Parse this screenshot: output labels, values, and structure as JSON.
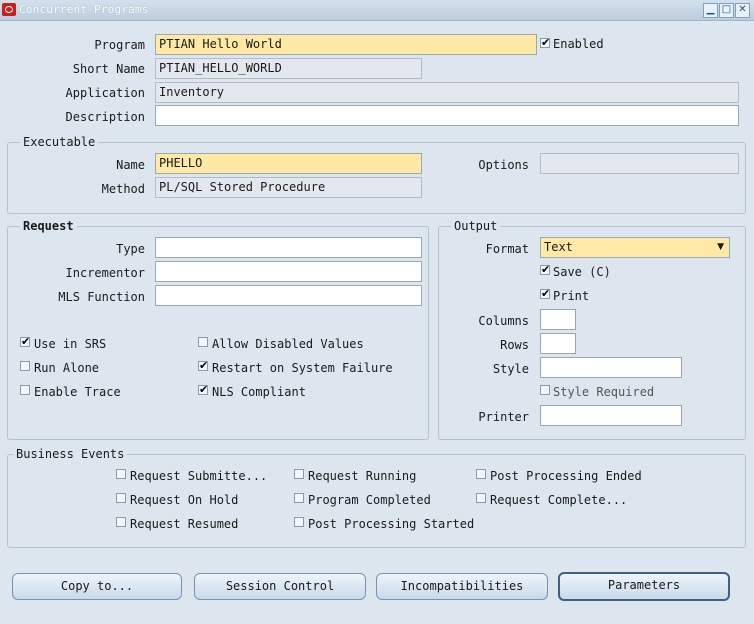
{
  "window": {
    "title": "Concurrent Programs",
    "minimize_icon": "minimize-icon",
    "maximize_icon": "maximize-icon",
    "close_icon": "close-icon"
  },
  "program": {
    "program_label": "Program",
    "program_value": "PTIAN Hello World",
    "enabled_label": "Enabled",
    "enabled_checked": true,
    "short_name_label": "Short Name",
    "short_name_value": "PTIAN_HELLO_WORLD",
    "application_label": "Application",
    "application_value": "Inventory",
    "description_label": "Description",
    "description_value": ""
  },
  "executable": {
    "title": "Executable",
    "name_label": "Name",
    "name_value": "PHELLO",
    "method_label": "Method",
    "method_value": "PL/SQL Stored Procedure",
    "options_label": "Options",
    "options_value": ""
  },
  "request": {
    "title": "Request",
    "type_label": "Type",
    "type_value": "",
    "incrementor_label": "Incrementor",
    "incrementor_value": "",
    "mls_label": "MLS Function",
    "mls_value": "",
    "use_in_srs": {
      "label": "Use in SRS",
      "checked": true
    },
    "run_alone": {
      "label": "Run Alone",
      "checked": false
    },
    "enable_trace": {
      "label": "Enable Trace",
      "checked": false
    },
    "allow_disabled": {
      "label": "Allow Disabled Values",
      "checked": false
    },
    "restart": {
      "label": "Restart on System Failure",
      "checked": true
    },
    "nls": {
      "label": "NLS Compliant",
      "checked": true
    }
  },
  "output": {
    "title": "Output",
    "format_label": "Format",
    "format_value": "Text",
    "save": {
      "label": "Save (C)",
      "checked": true
    },
    "print": {
      "label": "Print",
      "checked": true
    },
    "columns_label": "Columns",
    "columns_value": "",
    "rows_label": "Rows",
    "rows_value": "",
    "style_label": "Style",
    "style_value": "",
    "style_required": {
      "label": "Style Required",
      "checked": false
    },
    "printer_label": "Printer",
    "printer_value": ""
  },
  "business_events": {
    "title": "Business Events",
    "submitted": {
      "label": "Request Submitte...",
      "checked": false
    },
    "on_hold": {
      "label": "Request On Hold",
      "checked": false
    },
    "resumed": {
      "label": "Request Resumed",
      "checked": false
    },
    "running": {
      "label": "Request Running",
      "checked": false
    },
    "program_completed": {
      "label": "Program Completed",
      "checked": false
    },
    "post_started": {
      "label": "Post Processing Started",
      "checked": false
    },
    "post_ended": {
      "label": "Post Processing Ended",
      "checked": false
    },
    "request_completed": {
      "label": "Request Complete...",
      "checked": false
    }
  },
  "buttons": {
    "copy_to": "Copy to...",
    "session_control": "Session Control",
    "incompatibilities": "Incompatibilities",
    "parameters": "Parameters"
  }
}
